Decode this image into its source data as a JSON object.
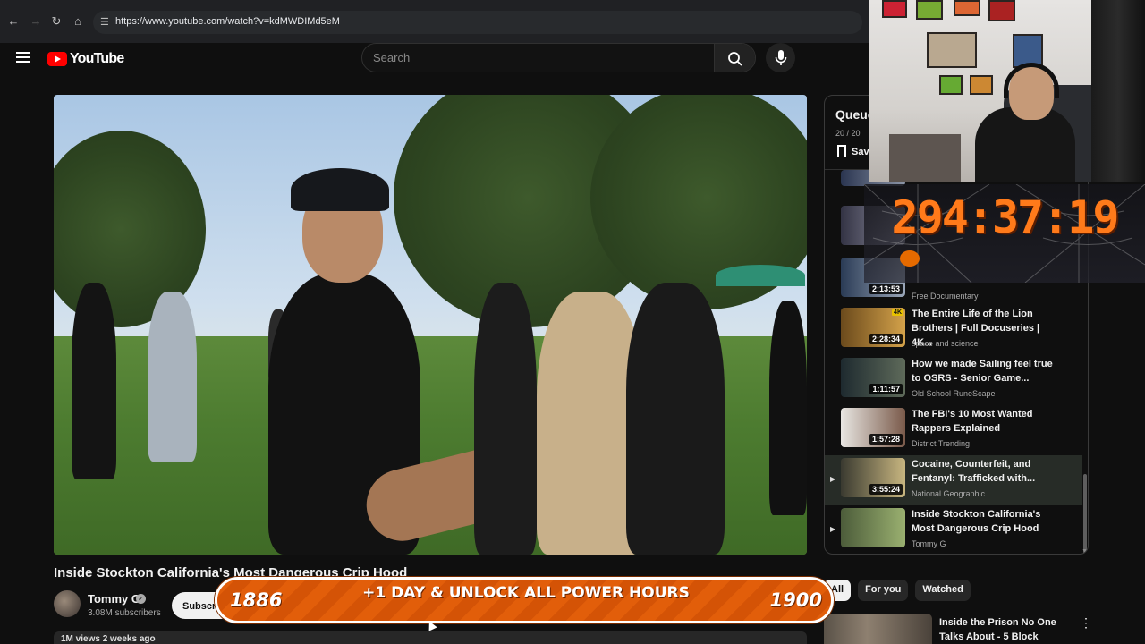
{
  "browser": {
    "url": "https://www.youtube.com/watch?v=kdMWDIMd5eM"
  },
  "header": {
    "logo_text": "YouTube",
    "search_placeholder": "Search"
  },
  "video": {
    "title": "Inside Stockton California's Most Dangerous Crip Hood",
    "channel": "Tommy G",
    "subscribers": "3.08M subscribers",
    "subscribe_label": "Subscribe",
    "description_snippet": "1M views  2 weeks ago"
  },
  "queue": {
    "title": "Queue",
    "count": "20 / 20",
    "save_label": "Save",
    "items": [
      {
        "title": "",
        "channel": "Free Documentary",
        "duration": "2:13:53",
        "active": false,
        "thumb": [
          "#2a3b55",
          "#9aa6b8"
        ]
      },
      {
        "title": "The Entire Life of the Lion Brothers | Full Docuseries | 4K...",
        "channel": "space and science",
        "duration": "2:28:34",
        "badge": "4K",
        "active": false,
        "thumb": [
          "#6b4a1c",
          "#d4a24a"
        ]
      },
      {
        "title": "How we made Sailing feel true to OSRS - Senior Game...",
        "channel": "Old School RuneScape",
        "duration": "1:11:57",
        "active": false,
        "thumb": [
          "#1e2a2f",
          "#5e6a5a"
        ]
      },
      {
        "title": "The FBI's 10 Most Wanted Rappers Explained",
        "channel": "District Trending",
        "duration": "1:57:28",
        "active": false,
        "thumb": [
          "#e8e6e2",
          "#7a5a4a"
        ]
      },
      {
        "title": "Cocaine, Counterfeit, and Fentanyl: Trafficked with...",
        "channel": "National Geographic",
        "duration": "3:55:24",
        "active": true,
        "thumb": [
          "#3a3a30",
          "#c8b680"
        ]
      },
      {
        "title": "Inside Stockton California's Most Dangerous Crip Hood",
        "channel": "Tommy G",
        "duration": "",
        "active": false,
        "thumb": [
          "#4c5c3a",
          "#9ab070"
        ]
      }
    ]
  },
  "chips": [
    {
      "label": "All",
      "selected": true
    },
    {
      "label": "For you",
      "selected": false
    },
    {
      "label": "Watched",
      "selected": false
    }
  ],
  "next_video": {
    "title": "Inside the Prison No One Talks About - 5 Block"
  },
  "overlay": {
    "timer": "294:37:19",
    "banner_left": "1886",
    "banner_center": "+1 DAY & UNLOCK ALL POWER HOURS",
    "banner_right": "1900"
  },
  "colors": {
    "accent": "#ff0000",
    "timer": "#ff7a1a",
    "banner": "#e25e0a"
  }
}
